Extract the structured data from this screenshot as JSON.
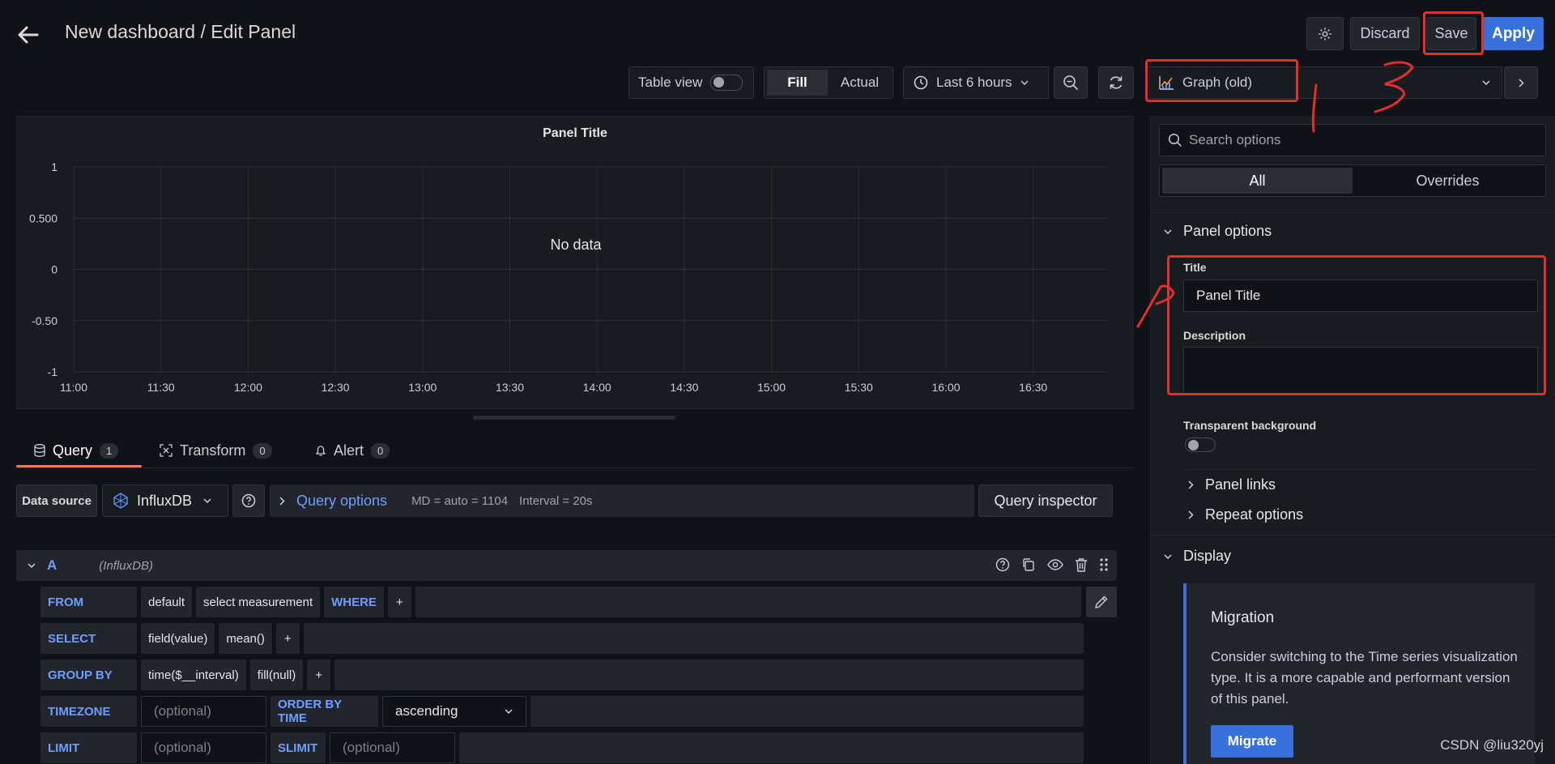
{
  "header": {
    "title": "New dashboard / Edit Panel",
    "discard_label": "Discard",
    "save_label": "Save",
    "apply_label": "Apply"
  },
  "toolbar": {
    "table_view_label": "Table view",
    "fill_label": "Fill",
    "actual_label": "Actual",
    "time_range": "Last 6 hours",
    "visualization": "Graph (old)"
  },
  "panel": {
    "title": "Panel Title",
    "no_data": "No data"
  },
  "chart_data": {
    "type": "line",
    "title": "Panel Title",
    "x": [
      "11:00",
      "11:30",
      "12:00",
      "12:30",
      "13:00",
      "13:30",
      "14:00",
      "14:30",
      "15:00",
      "15:30",
      "16:00",
      "16:30"
    ],
    "y_ticks": [
      "1",
      "0.500",
      "0",
      "-0.50",
      "-1"
    ],
    "ylim": [
      -1,
      1
    ],
    "series": [],
    "grid": true
  },
  "tabs": [
    {
      "label": "Query",
      "count": "1"
    },
    {
      "label": "Transform",
      "count": "0"
    },
    {
      "label": "Alert",
      "count": "0"
    }
  ],
  "query": {
    "data_source_label": "Data source",
    "data_source": "InfluxDB",
    "options_label": "Query options",
    "md": "MD = auto = 1104",
    "interval": "Interval = 20s",
    "inspector_label": "Query inspector",
    "ref_id": "A",
    "ref_ds": "(InfluxDB)",
    "from_kw": "FROM",
    "from_policy": "default",
    "from_measurement": "select measurement",
    "where_kw": "WHERE",
    "plus": "+",
    "select_kw": "SELECT",
    "select_field": "field(value)",
    "select_agg": "mean()",
    "group_kw": "GROUP BY",
    "group_time": "time($__interval)",
    "group_fill": "fill(null)",
    "timezone_kw": "TIMEZONE",
    "optional": "(optional)",
    "order_kw": "ORDER BY TIME",
    "order_value": "ascending",
    "limit_kw": "LIMIT",
    "slimit_kw": "SLIMIT"
  },
  "options_pane": {
    "search_placeholder": "Search options",
    "tab_all": "All",
    "tab_overrides": "Overrides",
    "panel_options": "Panel options",
    "title_label": "Title",
    "title_value": "Panel Title",
    "description_label": "Description",
    "transparent_label": "Transparent background",
    "panel_links": "Panel links",
    "repeat_options": "Repeat options",
    "display": "Display",
    "migration_title": "Migration",
    "migration_text": "Consider switching to the Time series visualization type. It is a more capable and performant version of this panel.",
    "migrate_label": "Migrate"
  },
  "watermark": "CSDN @liu320yj",
  "colors": {
    "background": "#111217",
    "panel": "#181b1f",
    "primary": "#3871dc",
    "annotation_red": "#e02f2f",
    "tab_accent": "#f5794a"
  }
}
